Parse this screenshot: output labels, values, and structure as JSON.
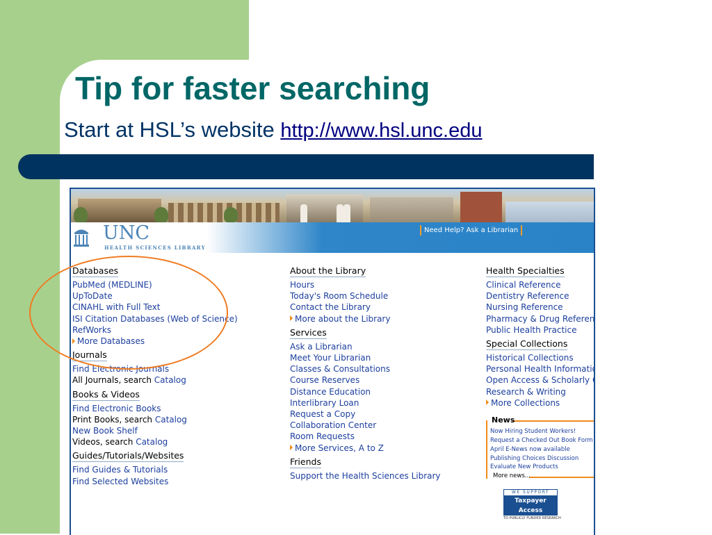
{
  "slide": {
    "title": "Tip for faster searching",
    "subtitle_prefix": "Start at HSL’s website ",
    "subtitle_link": "http://www.hsl.unc.edu"
  },
  "site": {
    "logo_unc": "UNC",
    "logo_subtitle": "HEALTH SCIENCES LIBRARY",
    "help_link": "Need Help? Ask a Librarian",
    "col1": {
      "databases_header": "Databases",
      "databases": [
        "PubMed (MEDLINE)",
        "UpToDate",
        "CINAHL with Full Text",
        "ISI Citation Databases (Web of Science)",
        "RefWorks"
      ],
      "more_databases": "More Databases",
      "journals_header": "Journals",
      "find_journals": "Find Electronic Journals",
      "all_journals_prefix": "All Journals, search ",
      "catalog": "Catalog",
      "books_header": "Books & Videos",
      "find_books": "Find Electronic Books",
      "print_books_prefix": "Print Books, search ",
      "new_book_shelf": "New Book Shelf",
      "videos_prefix": "Videos, search ",
      "guides_header": "Guides/Tutorials/Websites",
      "find_guides": "Find Guides & Tutorials",
      "find_websites": "Find Selected Websites"
    },
    "col2": {
      "about_header": "About the Library",
      "about": [
        "Hours",
        "Today's Room Schedule",
        "Contact the Library"
      ],
      "more_about": "More about the Library",
      "services_header": "Services",
      "services": [
        "Ask a Librarian",
        "Meet Your Librarian",
        "Classes & Consultations",
        "Course Reserves",
        "Distance Education",
        "Interlibrary Loan",
        "Request a Copy",
        "Collaboration Center",
        "Room Requests"
      ],
      "more_services": "More Services, A to Z",
      "friends_header": "Friends",
      "support": "Support the Health Sciences Library"
    },
    "col3": {
      "specialties_header": "Health Specialties",
      "specialties": [
        "Clinical Reference",
        "Dentistry Reference",
        "Nursing Reference",
        "Pharmacy & Drug Reference",
        "Public Health Practice"
      ],
      "collections_header": "Special Collections",
      "collections": [
        "Historical Collections",
        "Personal Health Information",
        "Open Access & Scholarly Com",
        "Research & Writing"
      ],
      "more_collections": "More Collections",
      "news_header": "News",
      "news": [
        "Now Hiring Student Workers!",
        "Request a Checked Out Book Form",
        "April E-News now available",
        "Publishing Choices Discussion",
        "Evaluate New Products"
      ],
      "more_news": "More news...",
      "badge_top": "WE SUPPORT",
      "badge_mid": "Taxpayer Access",
      "badge_bot": "TO PUBLICLY FUNDED RESEARCH"
    }
  },
  "colors": {
    "green": "#a8d08d",
    "title_teal": "#006666",
    "navy": "#00335f",
    "link_blue": "#1c3f9e",
    "accent_orange": "#f08a1a"
  }
}
